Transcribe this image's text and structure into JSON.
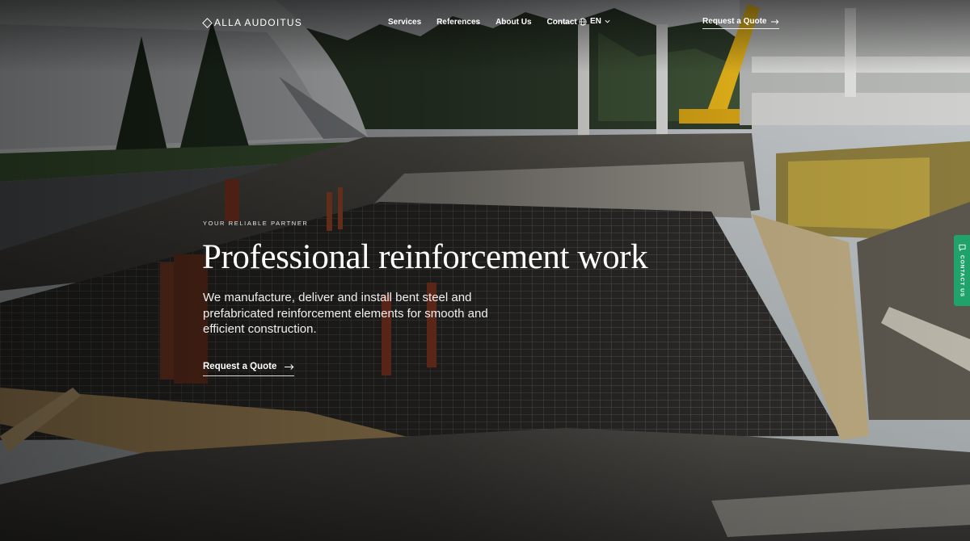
{
  "header": {
    "logo_text": "ALLA AUDOITUS",
    "nav": [
      {
        "label": "Services"
      },
      {
        "label": "References"
      },
      {
        "label": "About Us"
      },
      {
        "label": "Contact"
      }
    ],
    "language": {
      "label": "EN",
      "icon": "globe-icon"
    },
    "quote_label": "Request a Quote"
  },
  "hero": {
    "eyebrow": "YOUR RELIABLE PARTNER",
    "title": "Professional reinforcement work",
    "description": "We manufacture, deliver and install bent steel and prefabricated reinforcement elements for smooth and efficient construction.",
    "cta_label": "Request a Quote"
  },
  "contact_tab": {
    "label": "CONTACT US",
    "icon": "chat-icon"
  },
  "colors": {
    "accent_green": "#1fa36a",
    "text": "#ffffff"
  }
}
